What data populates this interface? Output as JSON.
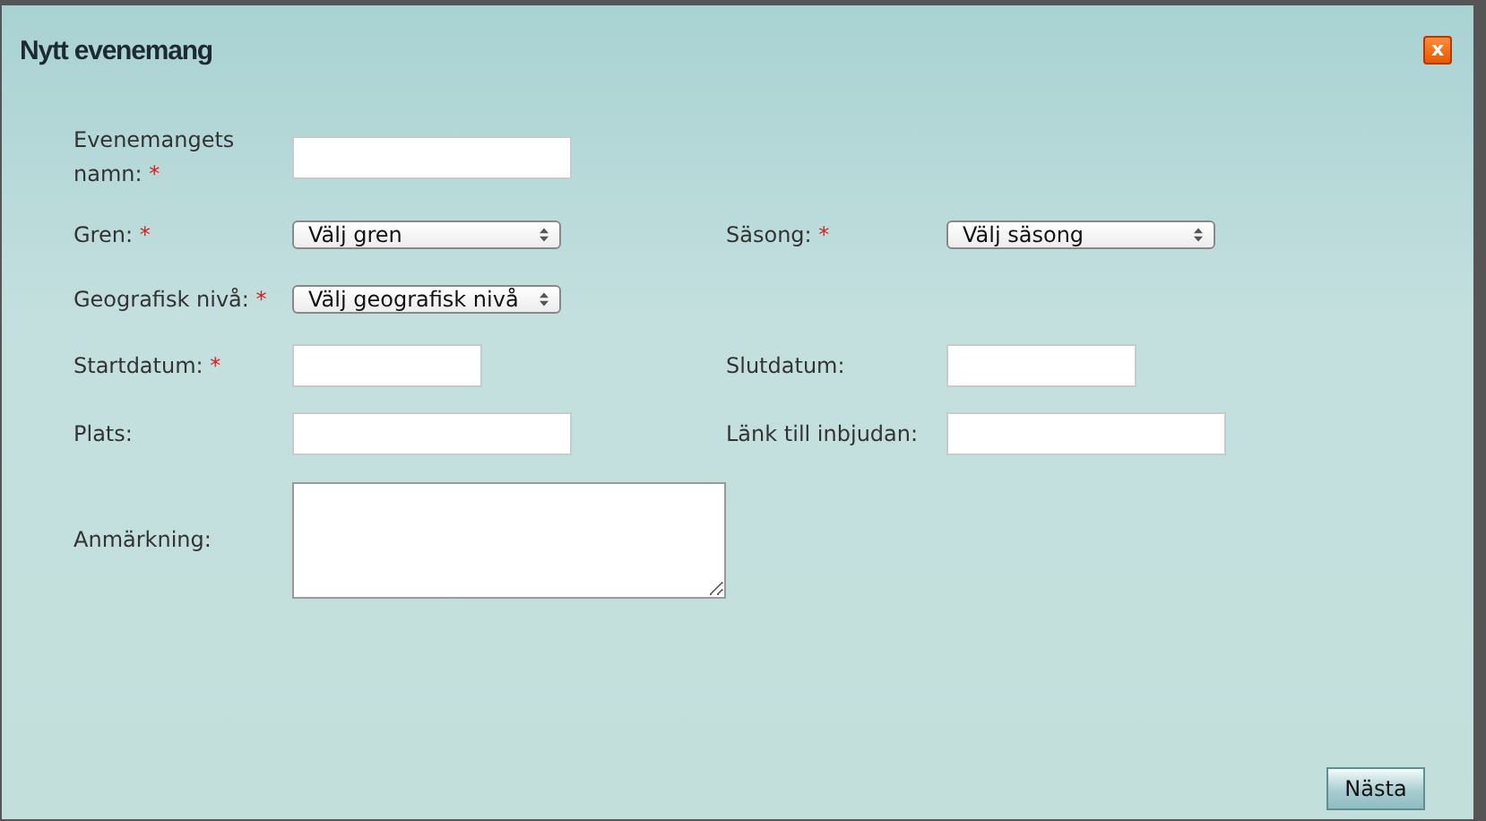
{
  "window": {
    "title": "Nytt evenemang",
    "close": "x"
  },
  "rows": [
    {
      "cells": [
        {
          "label": "Evenemangets namn:",
          "required_mark": "*",
          "kind": "text"
        }
      ]
    },
    {
      "cells": [
        {
          "label": "Gren:",
          "required_mark": "*",
          "kind": "select",
          "value": "Välj gren"
        },
        {
          "label": "Säsong:",
          "required_mark": "*",
          "kind": "select",
          "value": "Välj säsong"
        }
      ]
    },
    {
      "cells": [
        {
          "label": "Geografisk nivå:",
          "required_mark": "*",
          "kind": "select",
          "value": "Välj geografisk nivå"
        }
      ]
    },
    {
      "cells": [
        {
          "label": "Startdatum:",
          "required_mark": "*",
          "kind": "date"
        },
        {
          "label": "Slutdatum:",
          "kind": "date"
        }
      ]
    },
    {
      "cells": [
        {
          "label": "Plats:",
          "kind": "text"
        },
        {
          "label": "Länk till inbjudan:",
          "kind": "text"
        }
      ]
    },
    {
      "cells": [
        {
          "label": "Anmärkning:",
          "kind": "textarea"
        }
      ]
    }
  ],
  "buttons": [
    "Nästa"
  ]
}
